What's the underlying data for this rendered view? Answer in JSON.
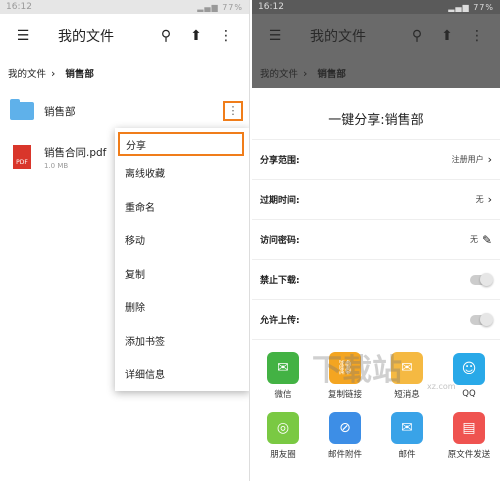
{
  "status": {
    "time": "16:12",
    "battery": "77%"
  },
  "left": {
    "title": "我的文件",
    "breadcrumb": {
      "root": "我的文件",
      "current": "销售部"
    },
    "files": [
      {
        "name": "销售部",
        "size": ""
      },
      {
        "name": "销售合同.pdf",
        "size": "1.0 MB"
      }
    ],
    "pdf_label": "PDF",
    "menu": [
      "分享",
      "离线收藏",
      "重命名",
      "移动",
      "复制",
      "删除",
      "添加书签",
      "详细信息"
    ]
  },
  "right": {
    "title": "我的文件",
    "breadcrumb": {
      "root": "我的文件",
      "current": "销售部"
    },
    "sheet_title": "一键分享:销售部",
    "settings": {
      "scope_label": "分享范围:",
      "scope_value": "注册用户",
      "expiry_label": "过期时间:",
      "expiry_value": "无",
      "password_label": "访问密码:",
      "password_value": "无",
      "no_download_label": "禁止下载:",
      "allow_upload_label": "允许上传:"
    },
    "share_targets": [
      {
        "label": "微信",
        "color": "#43b244",
        "icon": "wechat-icon",
        "glyph": "✉"
      },
      {
        "label": "复制链接",
        "color": "#f4a521",
        "icon": "link-icon",
        "glyph": "⛓"
      },
      {
        "label": "短消息",
        "color": "#f5b942",
        "icon": "sms-icon",
        "glyph": "✉"
      },
      {
        "label": "QQ",
        "color": "#29a9e8",
        "icon": "qq-icon",
        "glyph": "☺"
      },
      {
        "label": "朋友圈",
        "color": "#7ac943",
        "icon": "moments-icon",
        "glyph": "◎"
      },
      {
        "label": "邮件附件",
        "color": "#3d8ee6",
        "icon": "attachment-icon",
        "glyph": "⊘"
      },
      {
        "label": "邮件",
        "color": "#39a3e8",
        "icon": "mail-icon",
        "glyph": "✉"
      },
      {
        "label": "原文件发送",
        "color": "#ef5350",
        "icon": "file-send-icon",
        "glyph": "▤"
      }
    ]
  },
  "watermark": {
    "text": "下载站",
    "sub": "xz.com"
  },
  "colors": {
    "highlight": "#f07d1a",
    "folder": "#5fb1ea",
    "pdf": "#d9362b"
  }
}
